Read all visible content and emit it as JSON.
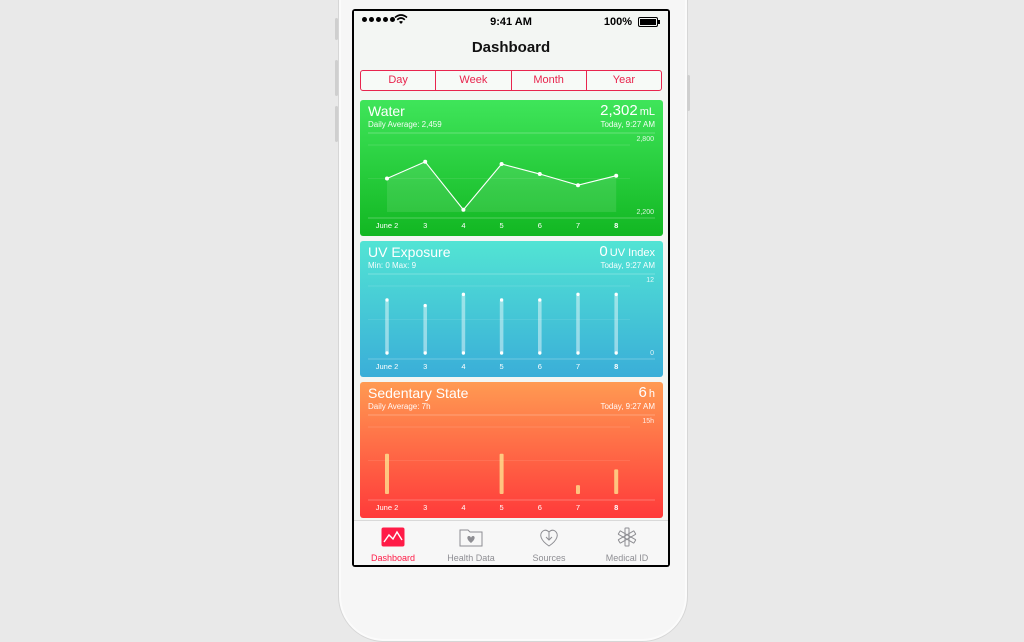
{
  "status_bar": {
    "time": "9:41 AM",
    "battery": "100%",
    "signal_icon": "signal-dots-icon",
    "wifi_icon": "wifi-icon",
    "battery_icon": "battery-icon"
  },
  "nav": {
    "title": "Dashboard"
  },
  "segments": [
    {
      "label": "Day",
      "active": false
    },
    {
      "label": "Week",
      "active": true
    },
    {
      "label": "Month",
      "active": false
    },
    {
      "label": "Year",
      "active": false
    }
  ],
  "colors": {
    "accent": "#ff1b47",
    "water_top": "#3fe55a",
    "water_bottom": "#12b722",
    "uv_top": "#52e4d4",
    "uv_bottom": "#3aaed8",
    "sedentary_top": "#ff9a52",
    "sedentary_bottom": "#ff3a3a"
  },
  "cards": [
    {
      "id": "water",
      "title": "Water",
      "subtitle": "Daily Average: 2,459",
      "value": "2,302",
      "unit": "mL",
      "time": "Today, 9:27 AM",
      "chart_data": {
        "type": "line",
        "categories": [
          "June 2",
          "3",
          "4",
          "5",
          "6",
          "7",
          "8"
        ],
        "values": [
          2500,
          2650,
          2220,
          2630,
          2540,
          2440,
          2525
        ],
        "ylim": [
          2200,
          2800
        ],
        "ytick_labels": [
          "2,800",
          "2,200"
        ]
      }
    },
    {
      "id": "uv",
      "title": "UV Exposure",
      "subtitle": "Min: 0  Max: 9",
      "value": "0",
      "unit": "UV Index",
      "time": "Today, 9:27 AM",
      "chart_data": {
        "type": "range-bar",
        "categories": [
          "June 2",
          "3",
          "4",
          "5",
          "6",
          "7",
          "8"
        ],
        "ranges": [
          [
            0,
            9.5
          ],
          [
            0,
            8.5
          ],
          [
            0,
            10.5
          ],
          [
            0,
            9.5
          ],
          [
            0,
            9.5
          ],
          [
            0,
            10.5
          ],
          [
            0,
            10.5
          ]
        ],
        "ylim": [
          0,
          12
        ],
        "ytick_labels": [
          "12",
          "0"
        ]
      }
    },
    {
      "id": "sedentary",
      "title": "Sedentary State",
      "subtitle": "Daily Average: 7h",
      "value": "6",
      "unit": "h",
      "time": "Today, 9:27 AM",
      "chart_data": {
        "type": "bar",
        "categories": [
          "June 2",
          "3",
          "4",
          "5",
          "6",
          "7",
          "8"
        ],
        "values": [
          9,
          0,
          0,
          9,
          0,
          2,
          5.5
        ],
        "ylim": [
          0,
          15
        ],
        "ytick_labels": [
          "15h"
        ]
      }
    }
  ],
  "tabs": [
    {
      "label": "Dashboard",
      "icon": "dashboard-chart-icon",
      "active": true
    },
    {
      "label": "Health Data",
      "icon": "health-data-folder-icon",
      "active": false
    },
    {
      "label": "Sources",
      "icon": "sources-download-heart-icon",
      "active": false
    },
    {
      "label": "Medical ID",
      "icon": "medical-id-asterisk-icon",
      "active": false
    }
  ]
}
